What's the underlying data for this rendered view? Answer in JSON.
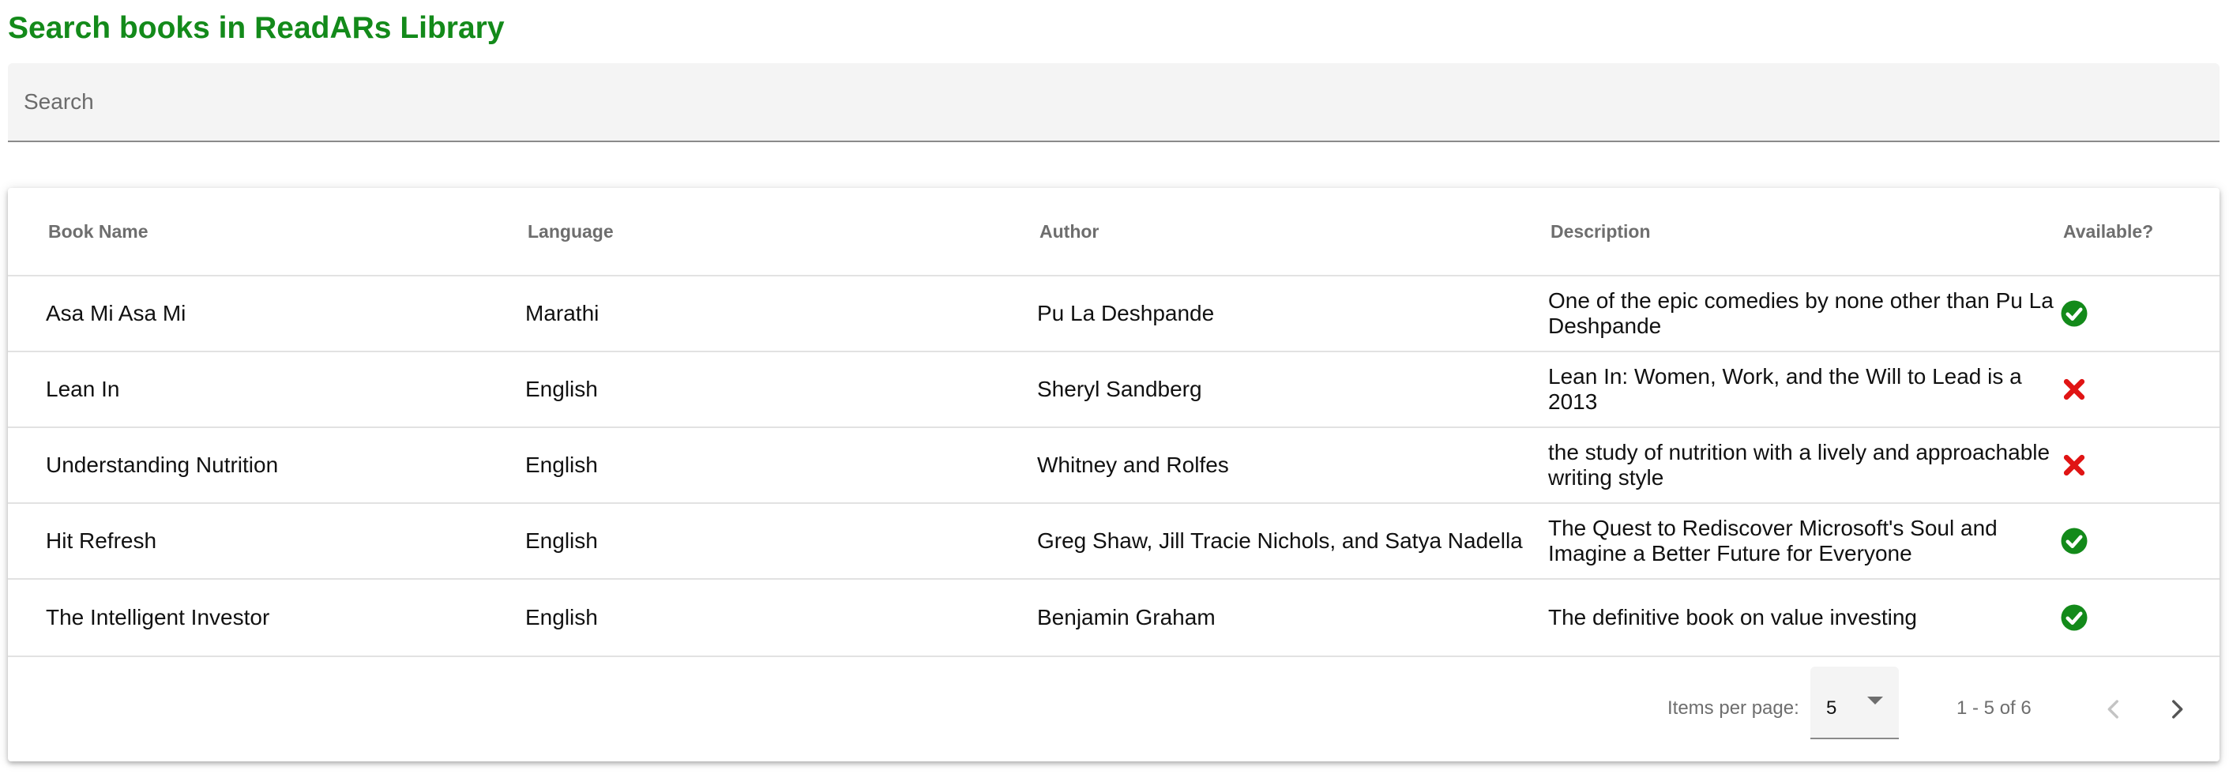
{
  "page": {
    "title": "Search books in ReadARs Library"
  },
  "search": {
    "placeholder": "Search",
    "value": ""
  },
  "table": {
    "columns": [
      "Book Name",
      "Language",
      "Author",
      "Description",
      "Available?"
    ],
    "rows": [
      {
        "name": "Asa Mi Asa Mi",
        "language": "Marathi",
        "author": "Pu La Deshpande",
        "description": "One of the epic comedies by none other than Pu La Deshpande",
        "available": true,
        "status_icon": "check-circle-icon"
      },
      {
        "name": "Lean In",
        "language": "English",
        "author": "Sheryl Sandberg",
        "description": "Lean In: Women, Work, and the Will to Lead is a 2013",
        "available": false,
        "status_icon": "close-x-icon"
      },
      {
        "name": "Understanding Nutrition",
        "language": "English",
        "author": "Whitney and Rolfes",
        "description": "the study of nutrition with a lively and approachable writing style",
        "available": false,
        "status_icon": "close-x-icon"
      },
      {
        "name": "Hit Refresh",
        "language": "English",
        "author": "Greg Shaw, Jill Tracie Nichols, and Satya Nadella",
        "description": "The Quest to Rediscover Microsoft's Soul and Imagine a Better Future for Everyone",
        "available": true,
        "status_icon": "check-circle-icon"
      },
      {
        "name": "The Intelligent Investor",
        "language": "English",
        "author": "Benjamin Graham",
        "description": "The definitive book on value investing",
        "available": true,
        "status_icon": "check-circle-icon"
      }
    ]
  },
  "paginator": {
    "items_per_page_label": "Items per page:",
    "items_per_page_value": "5",
    "range_label": "1 - 5 of 6",
    "prev_icon": "chevron-left-icon",
    "next_icon": "chevron-right-icon"
  },
  "colors": {
    "title": "#138a1a",
    "available": "#138a1a",
    "unavailable": "#e01414",
    "header_text": "#6e6e6e",
    "field_background": "#f4f4f4"
  }
}
